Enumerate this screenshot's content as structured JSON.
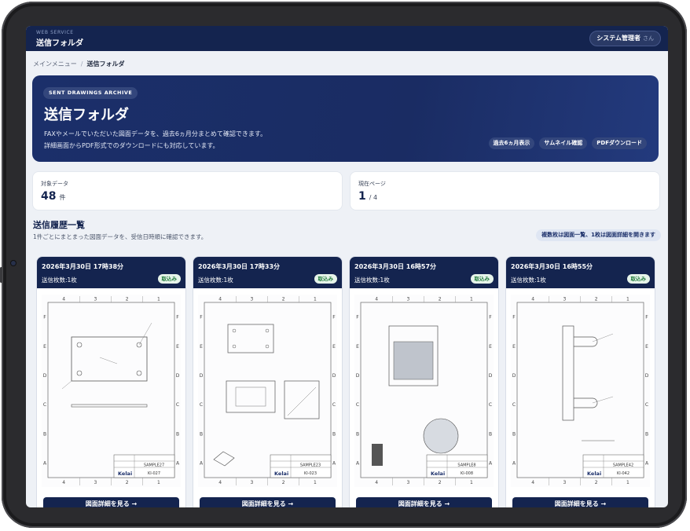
{
  "header": {
    "service_label": "WEB SERVICE",
    "title": "送信フォルダ",
    "user_name": "システム管理者",
    "user_suffix": "さん"
  },
  "breadcrumb": {
    "parent": "メインメニュー",
    "separator": "/",
    "current": "送信フォルダ"
  },
  "hero": {
    "tag": "SENT DRAWINGS ARCHIVE",
    "title": "送信フォルダ",
    "desc_line1": "FAXやメールでいただいた図面データを、過去6ヵ月分まとめて確認できます。",
    "desc_line2": "詳細画面からPDF形式でのダウンロードにも対応しています。",
    "pills": [
      "過去6ヵ月表示",
      "サムネイル確認",
      "PDFダウンロード"
    ]
  },
  "stats": [
    {
      "label": "対象データ",
      "value": "48",
      "unit": "件"
    },
    {
      "label": "現在ページ",
      "value": "1",
      "unit": "/ 4"
    }
  ],
  "section": {
    "title": "送信履歴一覧",
    "description": "1件ごとにまとまった図面データを、受信日時順に確認できます。",
    "note": "複数枚は図面一覧、1枚は図面詳細を開きます"
  },
  "cards": [
    {
      "date": "2026年3月30日 17時38分",
      "count": "送信枚数:1枚",
      "badge": "取込み",
      "sample": "SAMPLE27",
      "code": "KI-027",
      "button": "図面詳細を見る →"
    },
    {
      "date": "2026年3月30日 17時33分",
      "count": "送信枚数:1枚",
      "badge": "取込み",
      "sample": "SAMPLE23",
      "code": "KI-023",
      "button": "図面詳細を見る →"
    },
    {
      "date": "2026年3月30日 16時57分",
      "count": "送信枚数:1枚",
      "badge": "取込み",
      "sample": "SAMPLE8",
      "code": "KI-008",
      "button": "図面詳細を見る →"
    },
    {
      "date": "2026年3月30日 16時55分",
      "count": "送信枚数:1枚",
      "badge": "取込み",
      "sample": "SAMPLE42",
      "code": "KI-042",
      "button": "図面詳細を見る →"
    }
  ],
  "drawing": {
    "cols_top": [
      "4",
      "3",
      "2",
      "1"
    ],
    "rows_side": [
      "F",
      "E",
      "D",
      "C",
      "B",
      "A"
    ],
    "brand": "Kelai"
  }
}
